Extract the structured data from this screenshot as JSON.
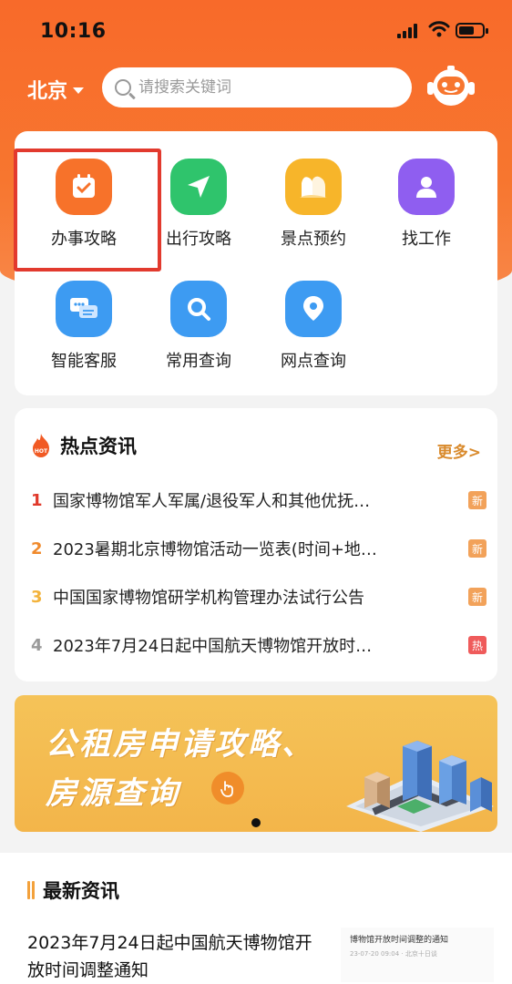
{
  "status_bar": {
    "time": "10:16"
  },
  "header": {
    "city": "北京",
    "search_placeholder": "请搜索关键词"
  },
  "services": [
    {
      "label": "办事攻略",
      "icon": "calendar-check-icon",
      "color": "#f7722a"
    },
    {
      "label": "出行攻略",
      "icon": "paper-plane-icon",
      "color": "#2fc46c"
    },
    {
      "label": "景点预约",
      "icon": "mountain-icon",
      "color": "#f7b52a"
    },
    {
      "label": "找工作",
      "icon": "person-icon",
      "color": "#8f5ef0"
    },
    {
      "label": "智能客服",
      "icon": "chat-bubbles-icon",
      "color": "#3d9bf2"
    },
    {
      "label": "常用查询",
      "icon": "magnifier-icon",
      "color": "#3d9bf2"
    },
    {
      "label": "网点查询",
      "icon": "location-pin-icon",
      "color": "#3d9bf2"
    }
  ],
  "hot_news": {
    "title": "热点资讯",
    "badge": "HOT",
    "more": "更多>",
    "items": [
      {
        "num": "1",
        "text": "国家博物馆军人军属/退役军人和其他优抚…",
        "tag": "新",
        "num_color": "#e0392b",
        "tag_color": "#f2a25a"
      },
      {
        "num": "2",
        "text": "2023暑期北京博物馆活动一览表(时间+地…",
        "tag": "新",
        "num_color": "#f08a2c",
        "tag_color": "#f2a25a"
      },
      {
        "num": "3",
        "text": "中国国家博物馆研学机构管理办法试行公告",
        "tag": "新",
        "num_color": "#f3b33c",
        "tag_color": "#f2a25a"
      },
      {
        "num": "4",
        "text": "2023年7月24日起中国航天博物馆开放时…",
        "tag": "热",
        "num_color": "#9a9a9a",
        "tag_color": "#ef5b5b"
      }
    ]
  },
  "banner": {
    "line1": "公租房申请攻略、",
    "line2": "房源查询"
  },
  "latest_news": {
    "title": "最新资讯",
    "item_title": "2023年7月24日起中国航天博物馆开放时间调整通知",
    "thumb_title": "博物馆开放时间调整的通知",
    "thumb_meta": "23-07-20 09:04 · 北京十日谈"
  },
  "colors": {
    "brand": "#f86a2a",
    "highlight_box": "#e23a2e",
    "more_link": "#d98a2c"
  }
}
